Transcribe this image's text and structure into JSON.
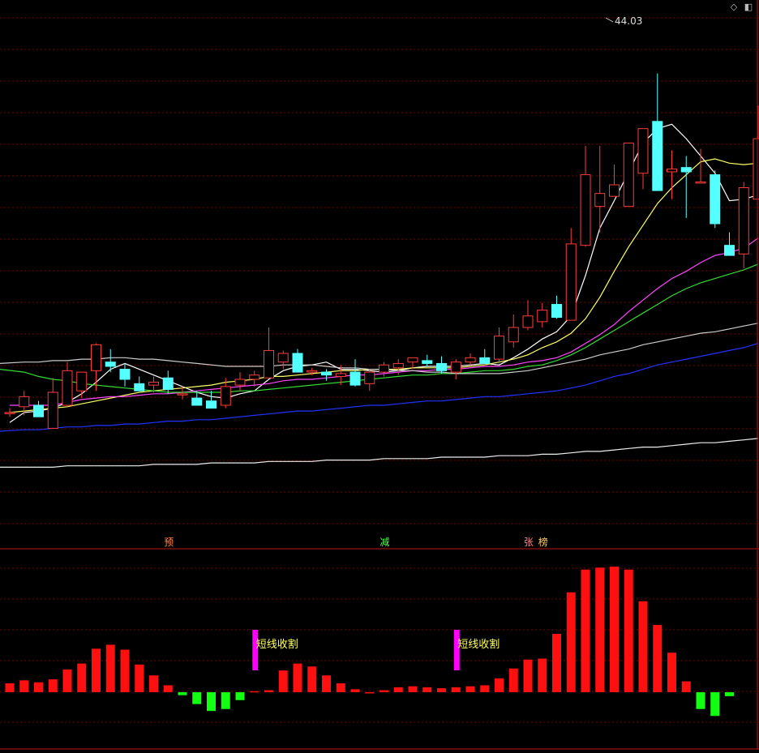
{
  "toolbar": {
    "diamond_icon": "diamond-icon",
    "panel_icon": "panel-toggle-icon"
  },
  "colors": {
    "background": "#000000",
    "grid": "#7a0000",
    "divider": "#9a1010",
    "up_candle": "#ff3a3a",
    "down_candle": "#54ffff",
    "ma_short": "#ffffff",
    "ma_10": "#ffff66",
    "ma_20": "#ff44ff",
    "ma_30": "#33dd33",
    "ma_60": "#cccccc",
    "ma_120": "#2233ff",
    "ma_250": "#eeeeee",
    "hist_pos": "#ff1010",
    "hist_neg": "#11ff11",
    "signal_bar": "#ff00ff",
    "signal_text": "#ffff55"
  },
  "chart_data": [
    {
      "type": "candlestick",
      "title": "",
      "y_scale": {
        "top_price": 48.0,
        "bottom_price": 12.0
      },
      "peak_label": "44.03",
      "ohlc": [
        [
          20.5,
          20.8,
          20.2,
          20.5
        ],
        [
          20.9,
          22.0,
          20.3,
          21.6
        ],
        [
          21.0,
          21.3,
          20.2,
          20.2
        ],
        [
          19.4,
          22.9,
          19.4,
          21.9
        ],
        [
          21.0,
          24.0,
          20.9,
          23.4
        ],
        [
          22.0,
          23.3,
          21.5,
          23.3
        ],
        [
          23.4,
          25.3,
          22.0,
          25.2
        ],
        [
          24.0,
          24.9,
          23.3,
          23.7
        ],
        [
          23.5,
          23.9,
          22.3,
          22.8
        ],
        [
          22.5,
          23.0,
          22.0,
          22.0
        ],
        [
          22.4,
          23.0,
          21.9,
          22.6
        ],
        [
          22.9,
          23.4,
          21.8,
          22.1
        ],
        [
          21.8,
          22.3,
          21.4,
          21.8
        ],
        [
          21.5,
          22.0,
          21.0,
          21.0
        ],
        [
          21.3,
          22.0,
          20.8,
          20.8
        ],
        [
          21.0,
          22.9,
          20.8,
          22.3
        ],
        [
          22.4,
          23.3,
          22.0,
          22.8
        ],
        [
          22.8,
          23.4,
          22.3,
          23.1
        ],
        [
          22.9,
          26.4,
          22.9,
          24.8
        ],
        [
          24.0,
          24.8,
          23.5,
          24.6
        ],
        [
          24.6,
          24.9,
          23.3,
          23.3
        ],
        [
          23.3,
          23.6,
          23.1,
          23.4
        ],
        [
          23.3,
          23.5,
          22.7,
          23.1
        ],
        [
          23.0,
          23.8,
          22.4,
          23.2
        ],
        [
          23.3,
          24.2,
          22.3,
          22.4
        ],
        [
          22.5,
          23.5,
          22.0,
          23.3
        ],
        [
          23.3,
          24.0,
          23.0,
          23.8
        ],
        [
          23.6,
          24.2,
          23.1,
          23.9
        ],
        [
          24.0,
          24.3,
          23.5,
          24.3
        ],
        [
          24.1,
          24.5,
          23.7,
          23.9
        ],
        [
          23.9,
          24.4,
          23.2,
          23.4
        ],
        [
          23.3,
          24.2,
          22.8,
          24.0
        ],
        [
          24.0,
          24.6,
          23.8,
          24.3
        ],
        [
          24.3,
          24.9,
          24.0,
          23.9
        ],
        [
          24.2,
          26.4,
          23.9,
          25.8
        ],
        [
          25.4,
          27.3,
          25.0,
          26.4
        ],
        [
          26.4,
          28.3,
          26.2,
          27.2
        ],
        [
          26.8,
          28.1,
          26.4,
          27.6
        ],
        [
          28.0,
          28.6,
          27.0,
          27.1
        ],
        [
          26.9,
          33.3,
          26.9,
          32.2
        ],
        [
          32.1,
          39.0,
          32.0,
          37.0
        ],
        [
          34.8,
          39.0,
          33.0,
          35.7
        ],
        [
          35.5,
          37.7,
          35.5,
          36.3
        ],
        [
          34.8,
          38.1,
          34.8,
          39.2
        ],
        [
          37.1,
          40.0,
          36.0,
          40.2
        ],
        [
          40.7,
          44.03,
          40.0,
          35.9
        ],
        [
          37.2,
          38.7,
          35.3,
          37.4
        ],
        [
          37.5,
          38.3,
          34.0,
          37.2
        ],
        [
          36.5,
          38.8,
          36.5,
          36.5
        ],
        [
          37.0,
          37.3,
          33.3,
          33.6
        ],
        [
          32.1,
          33.0,
          31.6,
          31.4
        ],
        [
          31.5,
          36.5,
          30.5,
          36.1
        ],
        [
          35.3,
          41.8,
          35.3,
          39.5
        ]
      ],
      "ma_lines": [
        {
          "key": "ma_short",
          "values": [
            19.8,
            20.5,
            20.6,
            20.8,
            21.2,
            21.8,
            22.6,
            23.5,
            23.9,
            23.5,
            23.1,
            22.7,
            22.3,
            21.9,
            21.6,
            21.5,
            21.8,
            22.0,
            22.8,
            23.4,
            23.7,
            23.8,
            24.0,
            23.5,
            23.5,
            23.4,
            23.3,
            23.4,
            23.6,
            23.7,
            23.7,
            23.7,
            23.8,
            23.9,
            23.8,
            24.3,
            24.9,
            25.6,
            26.1,
            27.2,
            30.0,
            33.3,
            35.2,
            37.2,
            39.2,
            40.2,
            40.5,
            39.5,
            38.3,
            37.1,
            35.2,
            35.3,
            35.6
          ]
        },
        {
          "key": "ma_10",
          "values": [
            20.5,
            20.6,
            20.7,
            20.8,
            20.9,
            21.1,
            21.3,
            21.5,
            21.7,
            21.9,
            22.0,
            22.1,
            22.2,
            22.3,
            22.4,
            22.6,
            22.7,
            22.8,
            23.0,
            23.0,
            23.1,
            23.2,
            23.3,
            23.4,
            23.4,
            23.5,
            23.5,
            23.5,
            23.6,
            23.6,
            23.6,
            23.6,
            23.7,
            23.8,
            24.0,
            24.2,
            24.5,
            25.0,
            25.4,
            26.0,
            27.0,
            28.5,
            30.3,
            32.0,
            33.5,
            35.0,
            36.1,
            37.0,
            37.9,
            38.1,
            37.8,
            37.7,
            37.8
          ]
        },
        {
          "key": "ma_20",
          "values": [
            21.0,
            21.0,
            21.0,
            21.0,
            21.2,
            21.4,
            21.5,
            21.6,
            21.6,
            21.7,
            21.8,
            21.8,
            21.9,
            22.0,
            22.1,
            22.2,
            22.3,
            22.4,
            22.5,
            22.7,
            22.8,
            22.8,
            22.9,
            23.0,
            23.1,
            23.1,
            23.2,
            23.3,
            23.4,
            23.4,
            23.5,
            23.5,
            23.6,
            23.7,
            23.7,
            23.8,
            24.0,
            24.1,
            24.3,
            24.7,
            25.3,
            25.9,
            26.6,
            27.5,
            28.3,
            29.1,
            29.8,
            30.3,
            30.9,
            31.4,
            31.6,
            31.9,
            32.6
          ]
        },
        {
          "key": "ma_30",
          "values": [
            23.5,
            23.3,
            23.0,
            22.8,
            22.7,
            22.5,
            22.4,
            22.3,
            22.2,
            22.1,
            22.0,
            21.9,
            21.9,
            21.9,
            21.9,
            21.9,
            22.0,
            22.0,
            22.1,
            22.2,
            22.3,
            22.4,
            22.5,
            22.6,
            22.7,
            22.8,
            22.9,
            23.0,
            23.1,
            23.1,
            23.2,
            23.2,
            23.3,
            23.4,
            23.4,
            23.5,
            23.7,
            23.8,
            24.1,
            24.5,
            25.0,
            25.6,
            26.2,
            26.8,
            27.4,
            28.0,
            28.6,
            29.1,
            29.5,
            29.8,
            30.1,
            30.4,
            30.8
          ]
        },
        {
          "key": "ma_60",
          "values": [
            23.9,
            24.0,
            24.0,
            24.1,
            24.1,
            24.2,
            24.2,
            24.3,
            24.3,
            24.2,
            24.2,
            24.1,
            24.0,
            23.9,
            23.8,
            23.7,
            23.7,
            23.7,
            23.7,
            23.8,
            23.8,
            23.8,
            23.7,
            23.6,
            23.6,
            23.5,
            23.5,
            23.4,
            23.4,
            23.3,
            23.3,
            23.2,
            23.2,
            23.2,
            23.2,
            23.3,
            23.4,
            23.6,
            23.8,
            24.0,
            24.2,
            24.5,
            24.7,
            24.9,
            25.2,
            25.4,
            25.6,
            25.8,
            26.0,
            26.1,
            26.3,
            26.5,
            26.7
          ]
        },
        {
          "key": "ma_120",
          "values": [
            19.2,
            19.3,
            19.3,
            19.4,
            19.5,
            19.5,
            19.6,
            19.6,
            19.7,
            19.7,
            19.8,
            19.9,
            19.9,
            20.0,
            20.0,
            20.1,
            20.2,
            20.3,
            20.4,
            20.5,
            20.6,
            20.6,
            20.7,
            20.8,
            20.9,
            21.0,
            21.0,
            21.1,
            21.2,
            21.3,
            21.3,
            21.4,
            21.5,
            21.6,
            21.6,
            21.7,
            21.8,
            21.9,
            22.0,
            22.2,
            22.4,
            22.7,
            23.0,
            23.2,
            23.5,
            23.8,
            24.0,
            24.2,
            24.4,
            24.6,
            24.8,
            25.0,
            25.3
          ]
        },
        {
          "key": "ma_250",
          "values": [
            16.7,
            16.7,
            16.7,
            16.7,
            16.8,
            16.8,
            16.8,
            16.8,
            16.8,
            16.8,
            16.9,
            16.9,
            16.9,
            16.9,
            17.0,
            17.0,
            17.0,
            17.0,
            17.1,
            17.1,
            17.1,
            17.1,
            17.2,
            17.2,
            17.2,
            17.2,
            17.3,
            17.3,
            17.3,
            17.3,
            17.4,
            17.4,
            17.4,
            17.4,
            17.5,
            17.5,
            17.5,
            17.6,
            17.6,
            17.7,
            17.8,
            17.8,
            17.9,
            18.0,
            18.1,
            18.1,
            18.2,
            18.3,
            18.4,
            18.4,
            18.5,
            18.6,
            18.7
          ]
        }
      ],
      "markers": [
        {
          "index": 11,
          "text": "预",
          "color": "#ff8844"
        },
        {
          "index": 26,
          "text": "减",
          "color": "#55ff55"
        },
        {
          "index": 36,
          "text": "张",
          "color": "#ff8888"
        },
        {
          "index": 37,
          "text": "榜",
          "color": "#ffcc66"
        }
      ]
    },
    {
      "type": "bar",
      "title": "",
      "y_scale": {
        "min": -2.0,
        "max": 11.0
      },
      "values": [
        0.9,
        1.2,
        1.0,
        1.3,
        2.3,
        2.9,
        4.4,
        4.8,
        4.3,
        2.8,
        1.7,
        0.7,
        -0.3,
        -1.2,
        -1.9,
        -1.7,
        -0.8,
        0.1,
        0.2,
        2.2,
        2.9,
        2.6,
        1.7,
        0.9,
        0.3,
        0.0,
        0.2,
        0.5,
        0.6,
        0.5,
        0.4,
        0.5,
        0.6,
        0.7,
        1.4,
        2.4,
        3.3,
        3.4,
        5.9,
        10.1,
        12.4,
        12.6,
        12.7,
        12.4,
        9.2,
        6.8,
        4.0,
        1.1,
        -1.7,
        -2.4,
        -0.4
      ],
      "signals": [
        {
          "index": 17,
          "text": "短线收割"
        },
        {
          "index": 31,
          "text": "短线收割"
        }
      ]
    }
  ]
}
